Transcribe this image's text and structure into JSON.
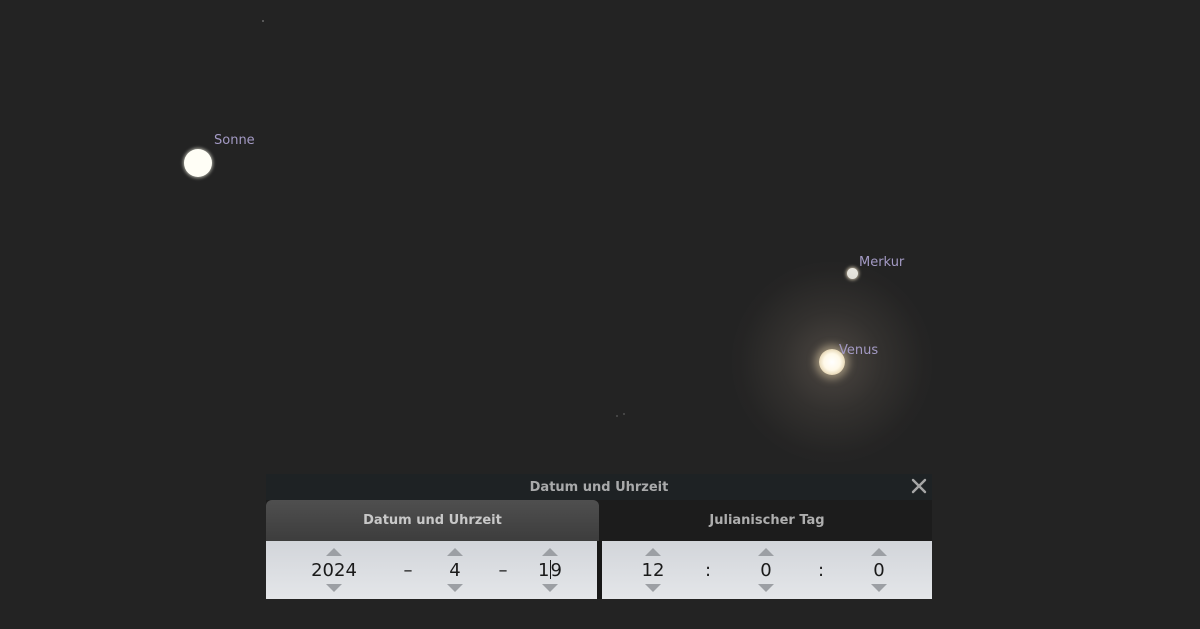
{
  "sky": {
    "objects": [
      {
        "name": "Sonne"
      },
      {
        "name": "Merkur"
      },
      {
        "name": "Venus"
      }
    ]
  },
  "dialog": {
    "title": "Datum und Uhrzeit",
    "close_icon": "close-icon",
    "tabs": [
      {
        "label": "Datum und Uhrzeit",
        "active": true
      },
      {
        "label": "Julianischer Tag",
        "active": false
      }
    ],
    "date": {
      "year": "2024",
      "month": "4",
      "day_before_caret": "1",
      "day_after_caret": "9",
      "separator": "–"
    },
    "time": {
      "hour": "12",
      "minute": "0",
      "second": "0",
      "separator": ":"
    }
  },
  "colors": {
    "sky_background": "#232323",
    "label_color": "#a39ac4",
    "panel_background": "#d2d5da"
  }
}
